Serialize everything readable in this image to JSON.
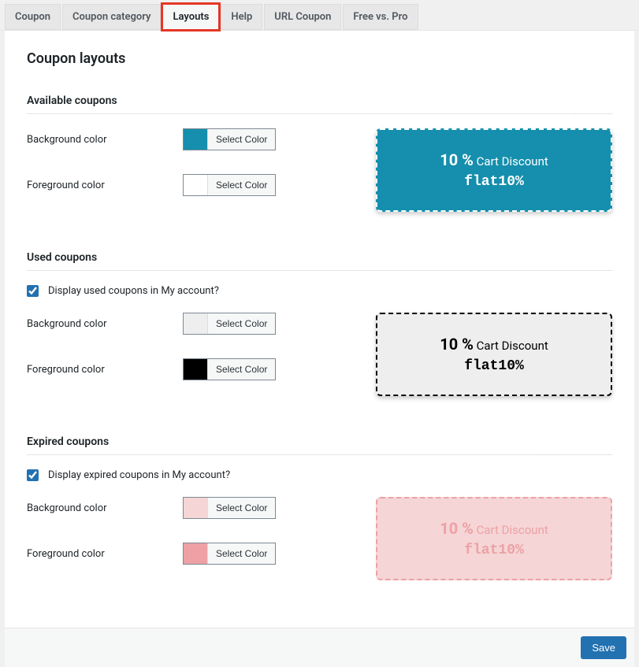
{
  "tabs": [
    {
      "label": "Coupon"
    },
    {
      "label": "Coupon category"
    },
    {
      "label": "Layouts",
      "active": true
    },
    {
      "label": "Help"
    },
    {
      "label": "URL Coupon"
    },
    {
      "label": "Free vs. Pro"
    }
  ],
  "page_title": "Coupon layouts",
  "select_color_label": "Select Color",
  "sections": {
    "available": {
      "title": "Available coupons",
      "bg_label": "Background color",
      "fg_label": "Foreground color",
      "bg_color": "#158fad",
      "fg_color": "#ffffff"
    },
    "used": {
      "title": "Used coupons",
      "checkbox_label": "Display used coupons in My account?",
      "bg_label": "Background color",
      "fg_label": "Foreground color",
      "bg_color": "#eeeeee",
      "fg_color": "#000000"
    },
    "expired": {
      "title": "Expired coupons",
      "checkbox_label": "Display expired coupons in My account?",
      "bg_label": "Background color",
      "fg_label": "Foreground color",
      "bg_color": "#f5d5d6",
      "fg_color": "#eda1a4"
    }
  },
  "coupon_preview": {
    "percent": "10 %",
    "discount_text": "Cart Discount",
    "code": "flat10%"
  },
  "save_label": "Save"
}
